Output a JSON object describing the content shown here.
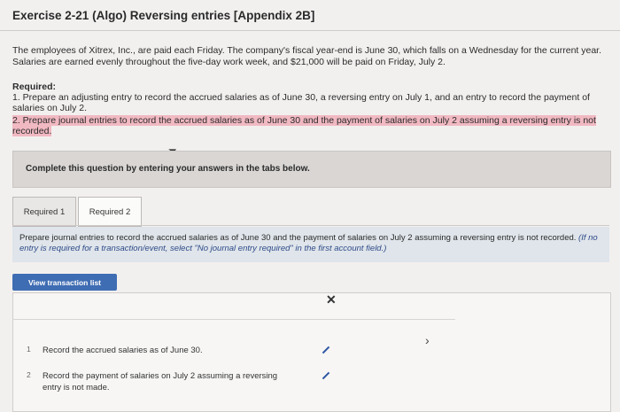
{
  "title": "Exercise 2-21 (Algo) Reversing entries [Appendix 2B]",
  "intro": "The employees of Xitrex, Inc., are paid each Friday. The company's fiscal year-end is June 30, which falls on a Wednesday for the current year. Salaries are earned evenly throughout the five-day work week, and $21,000 will be paid on Friday, July 2.",
  "required": {
    "heading": "Required:",
    "item1": "1. Prepare an adjusting entry to record the accrued salaries as of June 30, a reversing entry on July 1, and an entry to record the payment of salaries on July 2.",
    "item2": "2. Prepare journal entries to record the accrued salaries as of June 30 and the payment of salaries on July 2 assuming a reversing entry is not recorded."
  },
  "complete_instruction": "Complete this question by entering your answers in the tabs below.",
  "tabs": [
    {
      "label": "Required 1"
    },
    {
      "label": "Required 2"
    }
  ],
  "instructions": {
    "text": "Prepare journal entries to record the accrued salaries as of June 30 and the payment of salaries on July 2 assuming a reversing entry is not recorded.",
    "note": "(If no entry is required for a transaction/event, select \"No journal entry required\" in the first account field.)"
  },
  "view_transaction_list": "View transaction list",
  "transactions": [
    {
      "num": "1",
      "text": "Record the accrued salaries as of June 30."
    },
    {
      "num": "2",
      "text": "Record the payment of salaries on July 2 assuming a reversing entry is not made."
    }
  ],
  "icons": {
    "close": "close-icon",
    "next": "chevron-right-icon",
    "edit": "pencil-icon"
  },
  "colors": {
    "highlight": "#f1b9c2",
    "button": "#3f6db3",
    "instruction_bg": "#dfe5ea"
  }
}
